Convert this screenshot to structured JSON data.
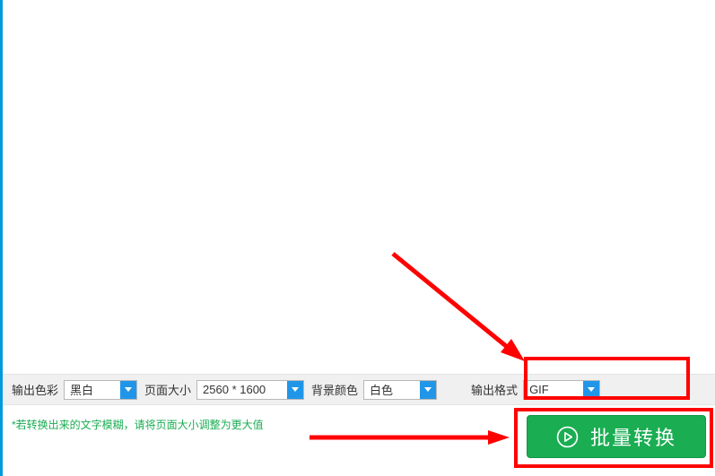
{
  "options": {
    "color": {
      "label": "输出色彩",
      "value": "黑白"
    },
    "size": {
      "label": "页面大小",
      "value": "2560 * 1600"
    },
    "bg": {
      "label": "背景颜色",
      "value": "白色"
    },
    "format": {
      "label": "输出格式",
      "value": "GIF"
    }
  },
  "hint": "*若转换出来的文字模糊，请将页面大小调整为更大值",
  "convert_button": "批量转换"
}
